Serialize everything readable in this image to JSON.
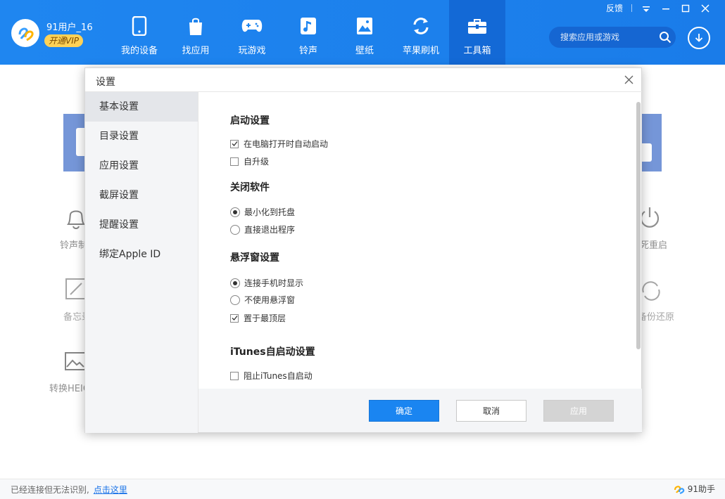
{
  "header": {
    "username": "91用户_16",
    "vip_label": "开通VIP",
    "nav": [
      {
        "label": "我的设备",
        "icon": "phone-icon"
      },
      {
        "label": "找应用",
        "icon": "shopping-bag-icon"
      },
      {
        "label": "玩游戏",
        "icon": "gamepad-icon"
      },
      {
        "label": "铃声",
        "icon": "music-note-icon"
      },
      {
        "label": "壁纸",
        "icon": "image-icon"
      },
      {
        "label": "苹果刷机",
        "icon": "refresh-icon"
      },
      {
        "label": "工具箱",
        "icon": "toolbox-icon"
      }
    ],
    "active_nav": "工具箱",
    "feedback": "反馈",
    "search_placeholder": "搜索应用或游戏"
  },
  "background_tools": {
    "left": [
      "铃声制",
      "备忘录",
      "转换HEIC"
    ],
    "right": [
      "死重启",
      "备份还原"
    ]
  },
  "dialog": {
    "title": "设置",
    "sidebar": [
      "基本设置",
      "目录设置",
      "应用设置",
      "截屏设置",
      "提醒设置",
      "绑定Apple ID"
    ],
    "active_tab": "基本设置",
    "sections": {
      "startup": {
        "title": "启动设置",
        "options": [
          {
            "label": "在电脑打开时自动启动",
            "checked": true
          },
          {
            "label": "自升级",
            "checked": false
          }
        ]
      },
      "close": {
        "title": "关闭软件",
        "options": [
          {
            "label": "最小化到托盘",
            "selected": true
          },
          {
            "label": "直接退出程序",
            "selected": false
          }
        ]
      },
      "float": {
        "title": "悬浮窗设置",
        "radios": [
          {
            "label": "连接手机时显示",
            "selected": true
          },
          {
            "label": "不使用悬浮窗",
            "selected": false
          }
        ],
        "checkbox": {
          "label": "置于最顶层",
          "checked": true
        }
      },
      "itunes": {
        "title": "iTunes自启动设置",
        "options": [
          {
            "label": "阻止iTunes自启动",
            "checked": false
          }
        ]
      }
    },
    "buttons": {
      "ok": "确定",
      "cancel": "取消",
      "apply": "应用"
    }
  },
  "statusbar": {
    "text": "已经连接但无法识别,",
    "link": "点击这里",
    "brand": "91助手"
  },
  "colors": {
    "header_blue": "#1f86f0",
    "active_nav": "#1369d6",
    "primary_button": "#1a85f1",
    "vip_gold": "#ffd257"
  }
}
